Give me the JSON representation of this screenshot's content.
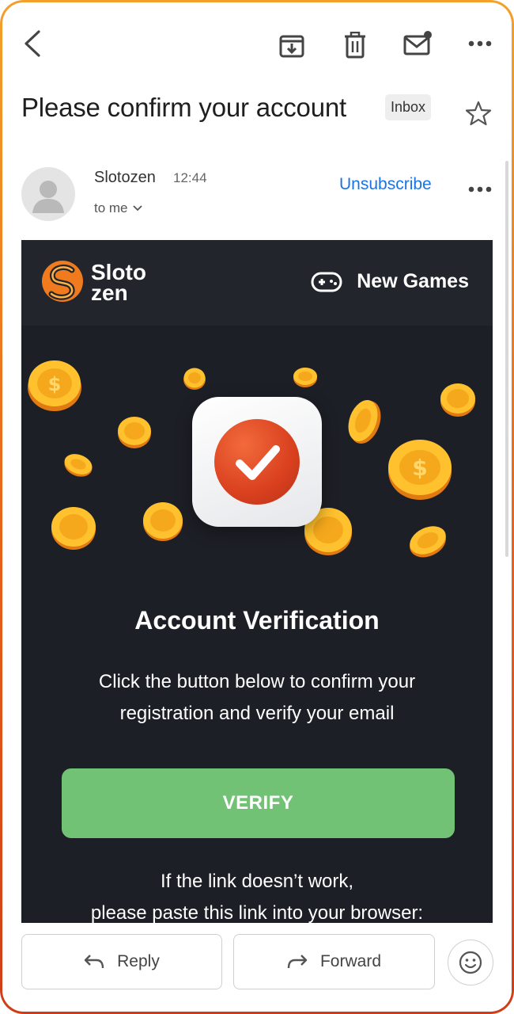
{
  "toolbar": {
    "back_icon": "arrow-left-icon",
    "archive_icon": "archive-icon",
    "delete_icon": "trash-icon",
    "mark_unread_icon": "mail-unread-icon",
    "more_icon": "more-horizontal-icon"
  },
  "message": {
    "subject": "Please confirm your account",
    "label": "Inbox",
    "star_icon": "star-outline-icon",
    "sender": "Slotozen",
    "time": "12:44",
    "recipient": "to me",
    "unsubscribe": "Unsubscribe"
  },
  "email_body": {
    "brand_line1": "Sloto",
    "brand_line2": "zen",
    "nav_label": "New Games",
    "heading": "Account Verification",
    "description_line1": "Click the button below to confirm your",
    "description_line2": "registration and verify your email",
    "verify_label": "VERIFY",
    "link_line1": "If the link doesn’t work,",
    "link_line2": "please paste this link into your browser:"
  },
  "actions": {
    "reply_label": "Reply",
    "forward_label": "Forward",
    "emoji_icon": "smiley-icon"
  },
  "colors": {
    "accent_link": "#1a73e8",
    "verify_button": "#72c275",
    "email_background": "#1d1f26",
    "brand_orange": "#f07a1e",
    "frame_top": "#f3a12a",
    "frame_bottom": "#cf3d17"
  }
}
